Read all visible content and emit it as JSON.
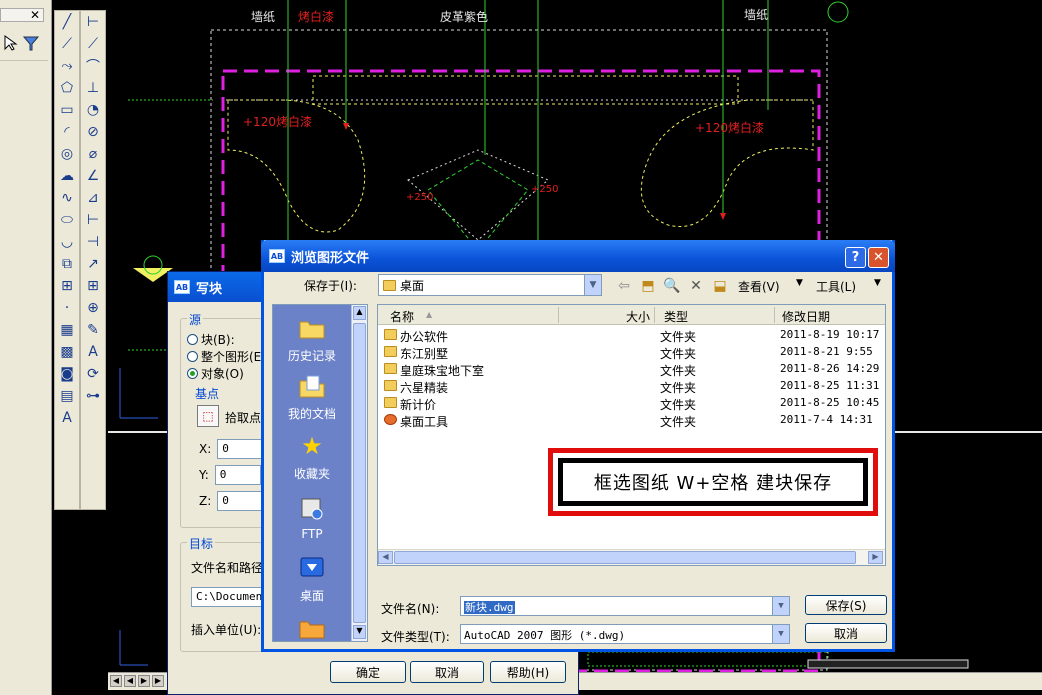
{
  "cad": {
    "labels": {
      "wallpaper_left": "墙纸",
      "paint_top": "烤白漆",
      "leather": "皮革紫色",
      "wallpaper_right": "墙纸",
      "paint_left": "+120烤白漆",
      "paint_right": "+120烤白漆",
      "dim_250_left": "+250",
      "dim_250_right": "+250"
    },
    "colors": {
      "magenta": "#e020e0",
      "yellow": "#f0f060",
      "green": "#30d030",
      "red": "#e02020",
      "white": "#e8e8e8"
    }
  },
  "write_block": {
    "title": "写块",
    "source_group": "源",
    "source_options": [
      "块(B):",
      "整个图形(E)",
      "对象(O)"
    ],
    "selected_source": "对象(O)",
    "base_point_group": "基点",
    "pick_point_label": "拾取点",
    "x_label": "X:",
    "x_value": "0",
    "y_label": "Y:",
    "y_value": "0",
    "z_label": "Z:",
    "z_value": "0",
    "target_group": "目标",
    "file_path_label": "文件名和路径",
    "file_path_value": "C:\\Document",
    "insert_units_label": "插入单位(U):",
    "ok_label": "确定",
    "cancel_label": "取消",
    "help_label": "帮助(H)"
  },
  "browse": {
    "title": "浏览图形文件",
    "look_in_label": "保存于(I):",
    "look_in_value": "桌面",
    "view_label": "查看(V)",
    "tools_label": "工具(L)",
    "places": [
      "历史记录",
      "我的文档",
      "收藏夹",
      "FTP",
      "桌面"
    ],
    "columns": [
      "名称",
      "大小",
      "类型",
      "修改日期"
    ],
    "files": [
      {
        "name": "办公软件",
        "type": "文件夹",
        "date": "2011-8-19 10:17",
        "icon": "folder-shortcut"
      },
      {
        "name": "东江别墅",
        "type": "文件夹",
        "date": "2011-8-21 9:55",
        "icon": "folder"
      },
      {
        "name": "皇庭珠宝地下室",
        "type": "文件夹",
        "date": "2011-8-26 14:29",
        "icon": "folder"
      },
      {
        "name": "六星精装",
        "type": "文件夹",
        "date": "2011-8-25 11:31",
        "icon": "folder"
      },
      {
        "name": "新计价",
        "type": "文件夹",
        "date": "2011-8-25 10:45",
        "icon": "folder"
      },
      {
        "name": "桌面工具",
        "type": "文件夹",
        "date": "2011-7-4 14:31",
        "icon": "app-folder"
      }
    ],
    "annotation": "框选图纸  W+空格 建块保存",
    "filename_label": "文件名(N):",
    "filename_value": "新块.dwg",
    "filetype_label": "文件类型(T):",
    "filetype_value": "AutoCAD 2007 图形 (*.dwg)",
    "save_label": "保存(S)",
    "cancel_label": "取消"
  }
}
